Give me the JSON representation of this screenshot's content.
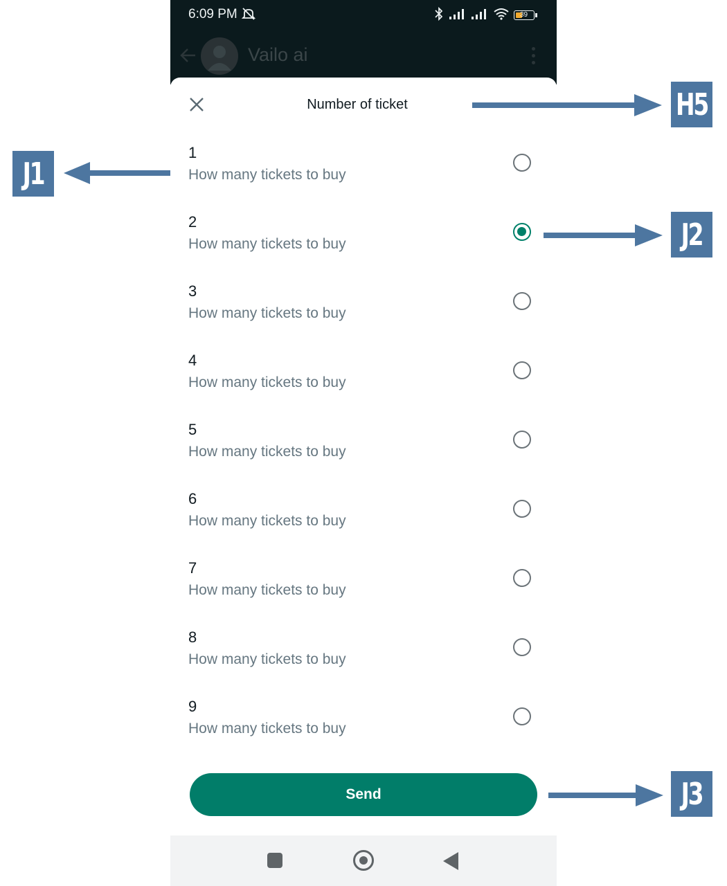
{
  "status_bar": {
    "time": "6:09 PM",
    "battery": "39"
  },
  "chat_header": {
    "contact_name": "Vailo ai"
  },
  "sheet": {
    "title": "Number of ticket",
    "options": [
      {
        "label": "1",
        "description": "How many tickets to buy",
        "selected": false
      },
      {
        "label": "2",
        "description": "How many tickets to buy",
        "selected": true
      },
      {
        "label": "3",
        "description": "How many tickets to buy",
        "selected": false
      },
      {
        "label": "4",
        "description": "How many tickets to buy",
        "selected": false
      },
      {
        "label": "5",
        "description": "How many tickets to buy",
        "selected": false
      },
      {
        "label": "6",
        "description": "How many tickets to buy",
        "selected": false
      },
      {
        "label": "7",
        "description": "How many tickets to buy",
        "selected": false
      },
      {
        "label": "8",
        "description": "How many tickets to buy",
        "selected": false
      },
      {
        "label": "9",
        "description": "How many tickets to buy",
        "selected": false
      }
    ],
    "send_label": "Send"
  },
  "annotations": {
    "title": "H5",
    "option_1": "J1",
    "option_2": "J2",
    "send": "J3"
  },
  "colors": {
    "accent": "#008069",
    "send_button": "#017d69",
    "annotation": "#4d76a0",
    "header_bg": "#0b1a1d"
  }
}
